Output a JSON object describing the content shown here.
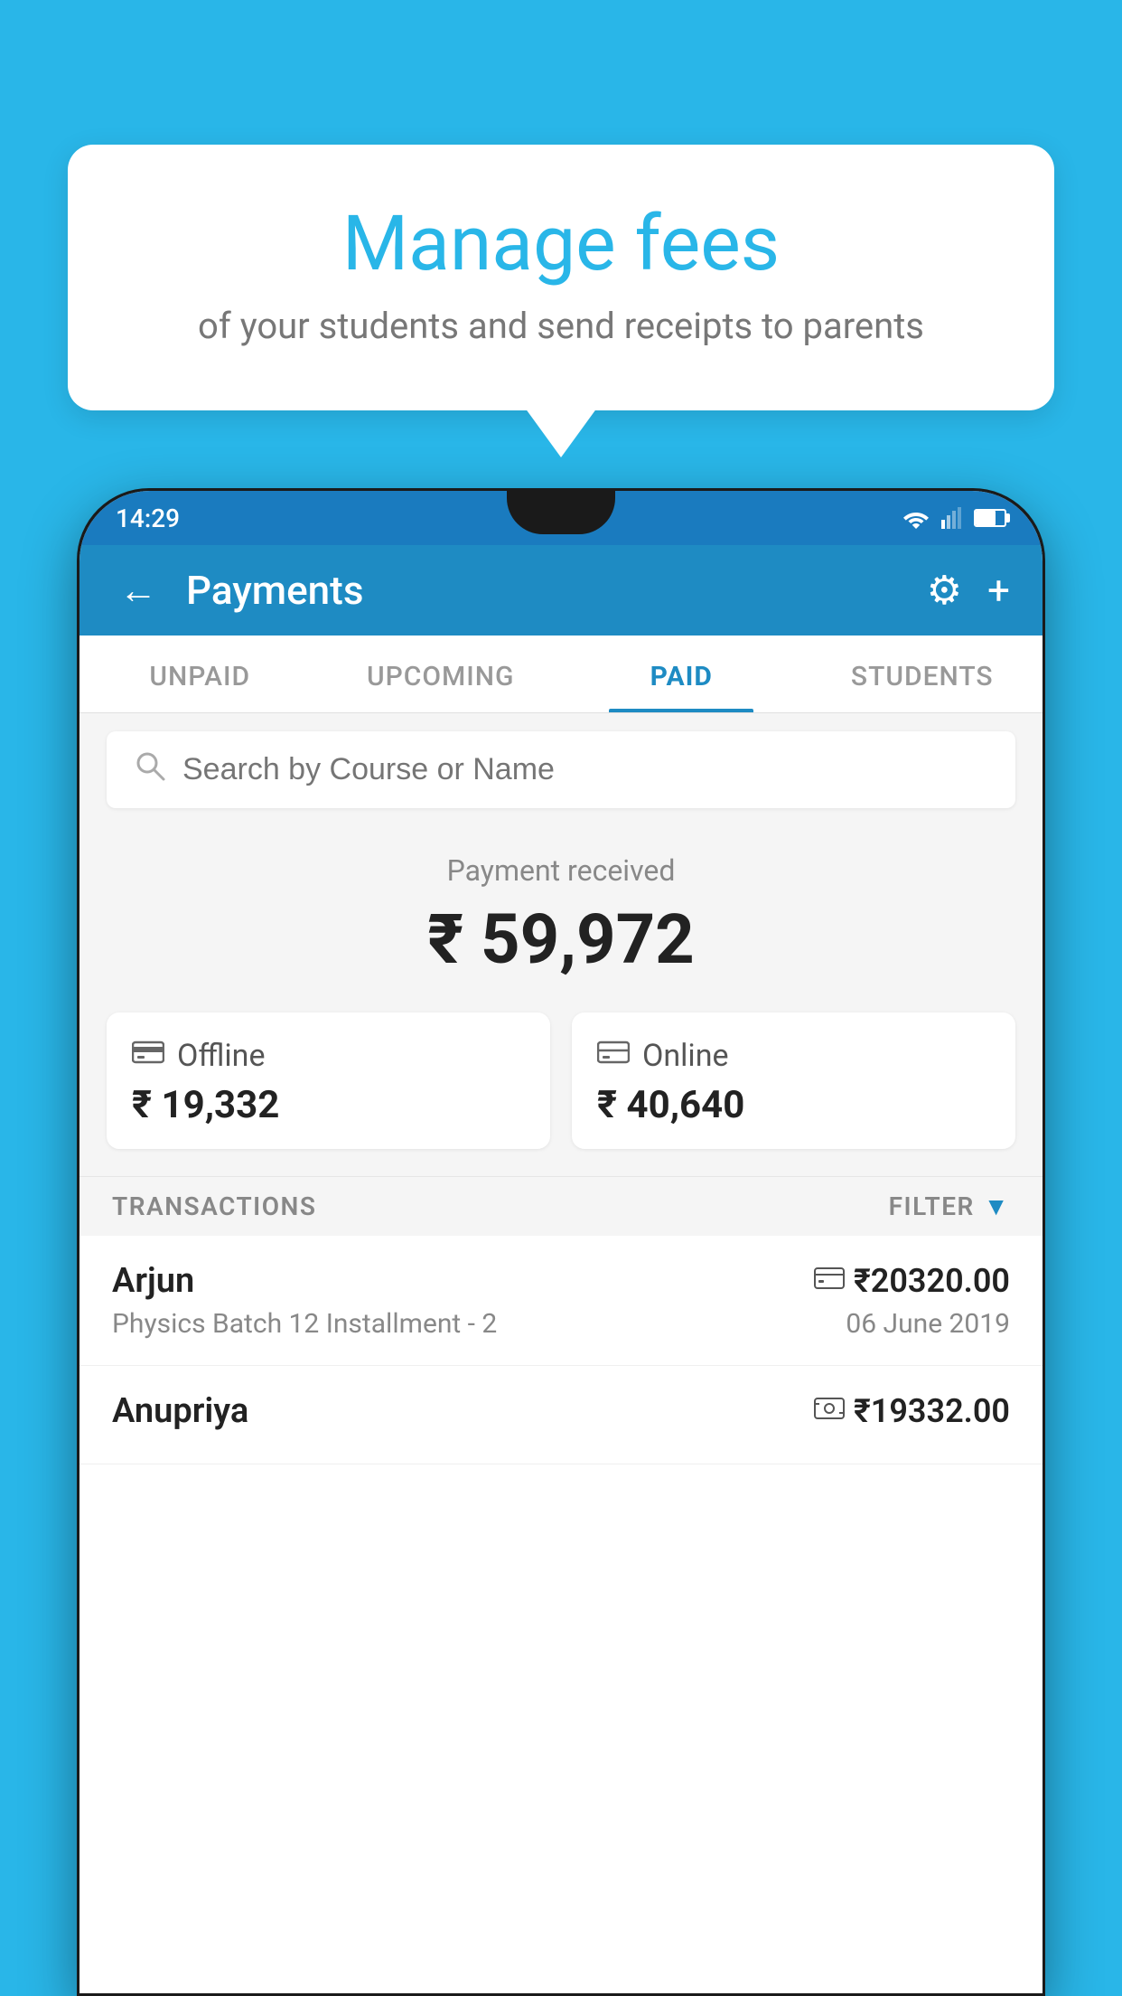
{
  "background_color": "#29B6E8",
  "speech_bubble": {
    "title": "Manage fees",
    "subtitle": "of your students and send receipts to parents"
  },
  "status_bar": {
    "time": "14:29"
  },
  "app_header": {
    "title": "Payments",
    "back_label": "←",
    "gear_label": "⚙",
    "plus_label": "+"
  },
  "tabs": [
    {
      "label": "UNPAID",
      "active": false
    },
    {
      "label": "UPCOMING",
      "active": false
    },
    {
      "label": "PAID",
      "active": true
    },
    {
      "label": "STUDENTS",
      "active": false
    }
  ],
  "search": {
    "placeholder": "Search by Course or Name"
  },
  "payment_received": {
    "label": "Payment received",
    "amount": "₹ 59,972"
  },
  "payment_cards": [
    {
      "type": "Offline",
      "amount": "₹ 19,332",
      "icon": "offline"
    },
    {
      "type": "Online",
      "amount": "₹ 40,640",
      "icon": "online"
    }
  ],
  "transactions_header": {
    "label": "TRANSACTIONS",
    "filter_label": "FILTER"
  },
  "transactions": [
    {
      "name": "Arjun",
      "course": "Physics Batch 12 Installment - 2",
      "amount": "₹20320.00",
      "date": "06 June 2019",
      "payment_type": "online"
    },
    {
      "name": "Anupriya",
      "course": "",
      "amount": "₹19332.00",
      "date": "",
      "payment_type": "offline"
    }
  ]
}
